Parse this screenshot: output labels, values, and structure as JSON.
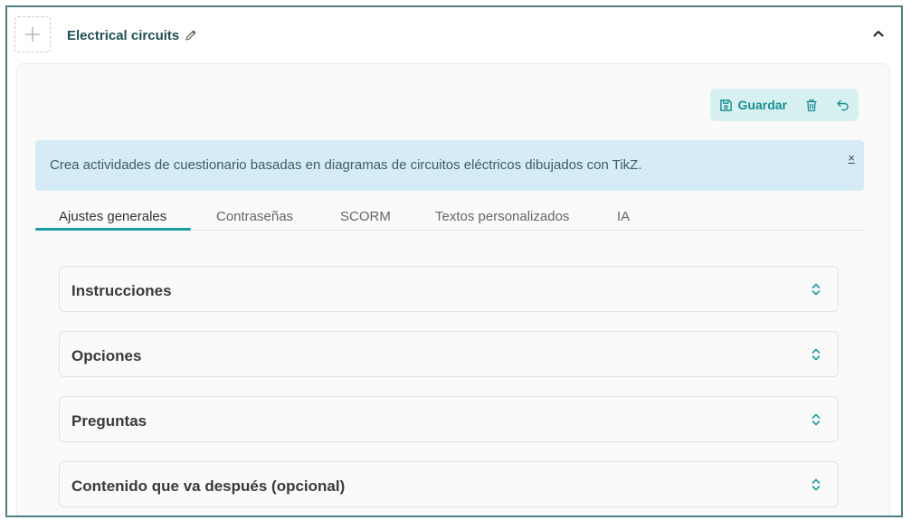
{
  "header": {
    "title": "Electrical circuits"
  },
  "toolbar": {
    "save_label": "Guardar"
  },
  "alert": {
    "text": "Crea actividades de cuestionario basadas en diagramas de circuitos eléctricos dibujados con TikZ.",
    "close": "×"
  },
  "tabs": [
    {
      "label": "Ajustes generales"
    },
    {
      "label": "Contraseñas"
    },
    {
      "label": "SCORM"
    },
    {
      "label": "Textos personalizados"
    },
    {
      "label": "IA"
    }
  ],
  "sections": [
    {
      "title": "Instrucciones"
    },
    {
      "title": "Opciones"
    },
    {
      "title": "Preguntas"
    },
    {
      "title": "Contenido que va después (opcional)"
    }
  ],
  "colors": {
    "accent": "#1a9da0",
    "frame_border": "#4f7f80",
    "alert_bg": "#d5ecf6",
    "toolbar_bg": "#d7f1f1",
    "title": "#1f4f52"
  },
  "icons": [
    "plus-icon",
    "pencil-icon",
    "chevron-up-icon",
    "save-icon",
    "trash-icon",
    "undo-icon",
    "close-icon",
    "expand-collapse-icon"
  ]
}
